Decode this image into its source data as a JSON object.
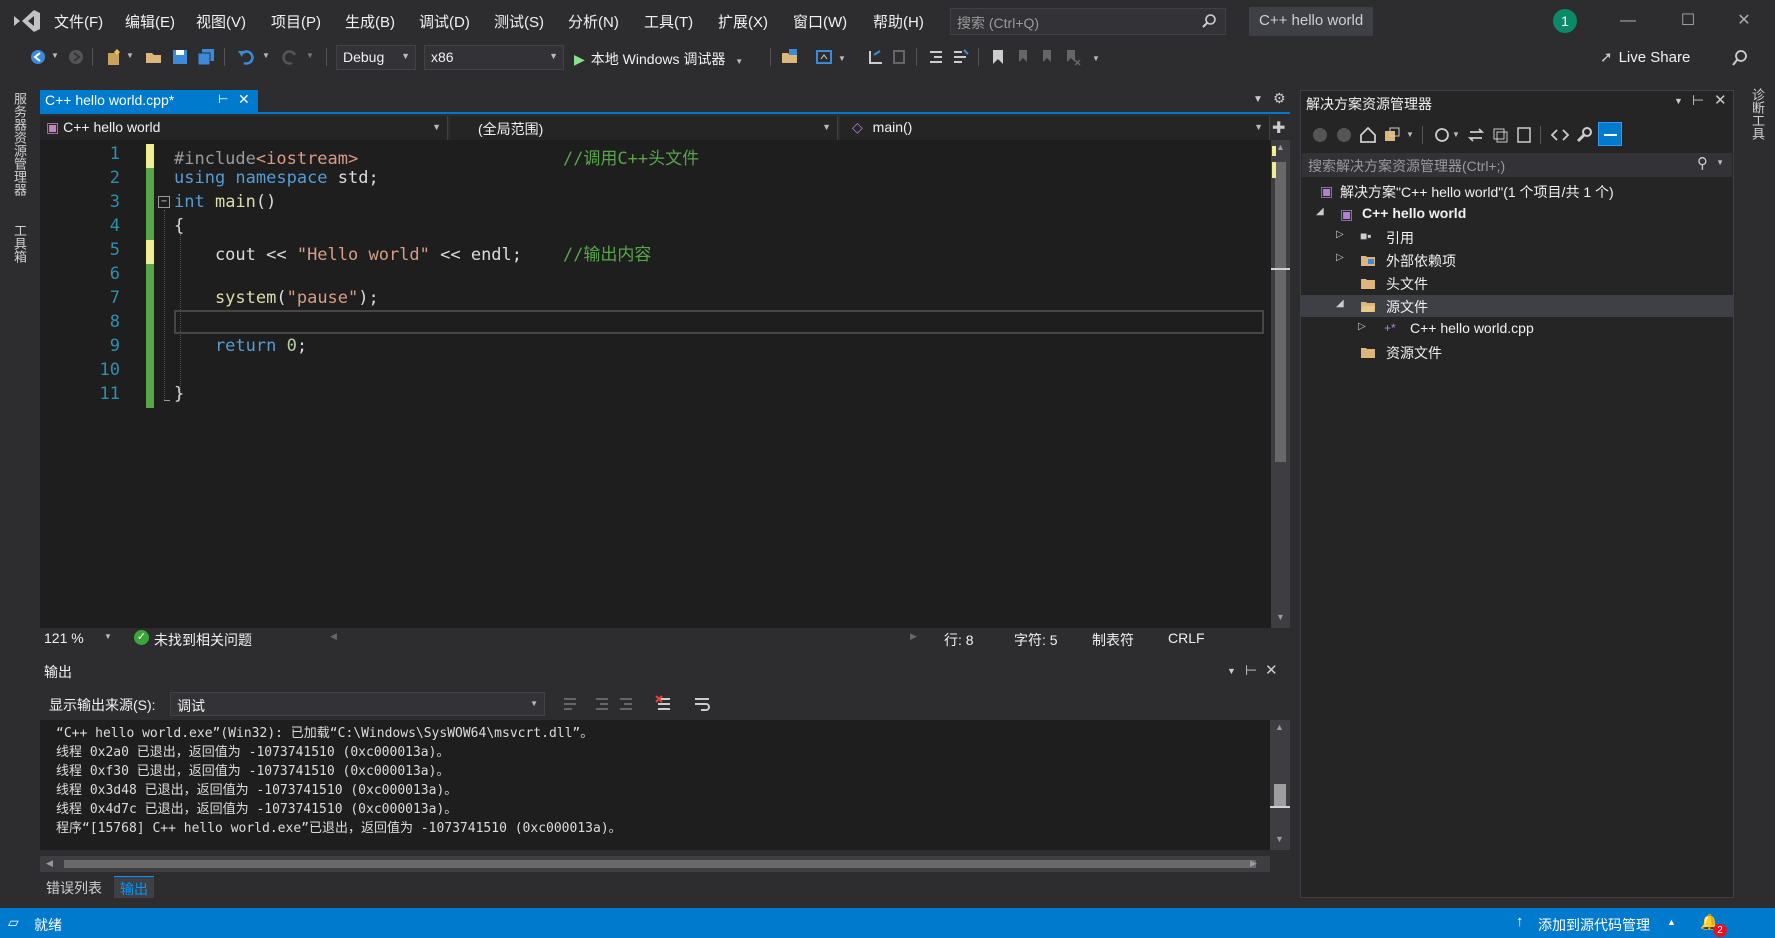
{
  "menu": [
    "文件(F)",
    "编辑(E)",
    "视图(V)",
    "项目(P)",
    "生成(B)",
    "调试(D)",
    "测试(S)",
    "分析(N)",
    "工具(T)",
    "扩展(X)",
    "窗口(W)",
    "帮助(H)"
  ],
  "search": {
    "placeholder": "搜索 (Ctrl+Q)"
  },
  "solution_title": "C++ hello world",
  "user_initial": "1",
  "toolbar": {
    "config": "Debug",
    "platform": "x86",
    "run_label": "本地 Windows 调试器",
    "live_share": "Live Share"
  },
  "left_rail": {
    "server_explorer": "服务器资源管理器",
    "toolbox": "工具箱"
  },
  "right_rail": {
    "diagnostics": "诊断工具"
  },
  "editor": {
    "tab_label": "C++ hello world.cpp*",
    "nav_project": "C++ hello world",
    "nav_scope": "(全局范围)",
    "nav_member": "main()",
    "line_numbers": [
      "1",
      "2",
      "3",
      "4",
      "5",
      "6",
      "7",
      "8",
      "9",
      "10",
      "11"
    ],
    "lines": [
      {
        "pre": "#include",
        "inc": "<iostream>",
        "pad": "                    ",
        "comment": "//调用C++头文件"
      },
      {
        "kw1": "using",
        "kw2": " namespace",
        "rest": " std;"
      },
      {
        "kw": "int",
        "fn": " main",
        "rest": "()"
      },
      {
        "rest": "{"
      },
      {
        "code1": "    cout << ",
        "str": "\"Hello world\"",
        "code2": " << endl;    ",
        "comment": "//输出内容"
      },
      {
        "rest": ""
      },
      {
        "fn": "    system",
        "rest1": "(",
        "str": "\"pause\"",
        "rest2": ");"
      },
      {
        "rest": ""
      },
      {
        "kw": "    return",
        "rest1": " ",
        "num": "0",
        "rest2": ";"
      },
      {
        "rest": ""
      },
      {
        "rest": "}"
      }
    ],
    "zoom": "121 %",
    "issues": "未找到相关问题",
    "line_info": "行: 8",
    "char_info": "字符: 5",
    "tab_mode": "制表符",
    "line_ending": "CRLF"
  },
  "output": {
    "title": "输出",
    "source_label": "显示输出来源(S):",
    "source_value": "调试",
    "lines": [
      "“C++ hello world.exe”(Win32): 已加载“C:\\Windows\\SysWOW64\\msvcrt.dll”。",
      "线程 0x2a0 已退出，返回值为 -1073741510 (0xc000013a)。",
      "线程 0xf30 已退出，返回值为 -1073741510 (0xc000013a)。",
      "线程 0x3d48 已退出，返回值为 -1073741510 (0xc000013a)。",
      "线程 0x4d7c 已退出，返回值为 -1073741510 (0xc000013a)。",
      "程序“[15768] C++ hello world.exe”已退出，返回值为 -1073741510 (0xc000013a)。"
    ]
  },
  "bottom_tabs": {
    "error_list": "错误列表",
    "output": "输出"
  },
  "solution_explorer": {
    "title": "解决方案资源管理器",
    "search_placeholder": "搜索解决方案资源管理器(Ctrl+;)",
    "tree": {
      "solution": "解决方案\"C++ hello world\"(1 个项目/共 1 个)",
      "project": "C++ hello world",
      "references": "引用",
      "external": "外部依赖项",
      "headers": "头文件",
      "sources": "源文件",
      "cpp_file": "C++ hello world.cpp",
      "resources": "资源文件"
    }
  },
  "statusbar": {
    "ready": "就绪",
    "source_control": "添加到源代码管理",
    "notifications": "2"
  },
  "colors": {
    "accent": "#007acc",
    "background": "#2d2d30",
    "editor_bg": "#1e1e1e",
    "keyword": "#569cd6",
    "string": "#d69d85",
    "comment": "#57a64a",
    "line_number": "#2b91af",
    "change_saved": "#57a64a",
    "change_unsaved": "#efef91"
  }
}
